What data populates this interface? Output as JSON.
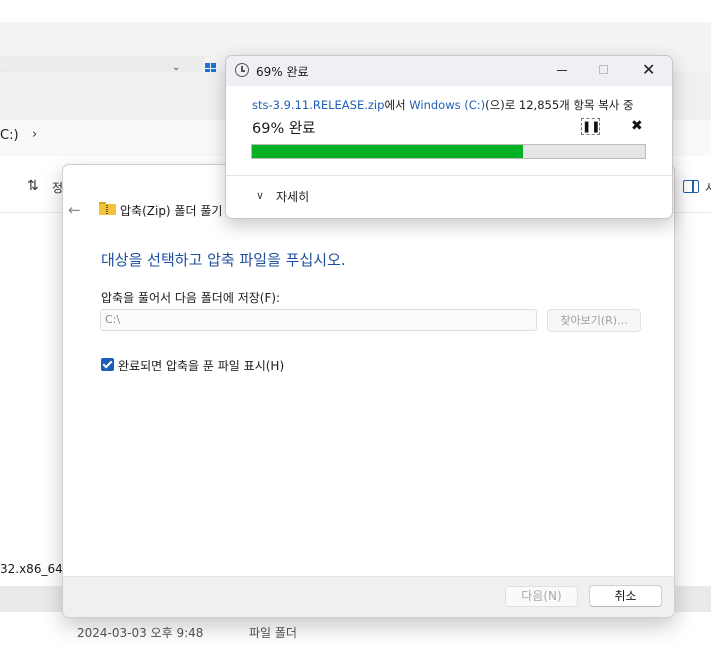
{
  "explorer": {
    "tab_partial": "‥‥",
    "tab_chevron": "⌄",
    "address_text": "C:)",
    "address_chevron": "›",
    "sort_icon": "⇅",
    "sort_label": "정",
    "details_label": "시",
    "file_partial_name": "32.x86_64...",
    "row_date": "2024-03-03 오후 9:48",
    "row_type": "파일 폴더"
  },
  "wizard": {
    "back_icon": "←",
    "title": "압축(Zip) 폴더 풀기",
    "heading": "대상을 선택하고 압축 파일을 푸십시오.",
    "dest_label": "압축을 풀어서 다음 폴더에 저장(F):",
    "dest_path": "C:\\",
    "browse_label": "찾아보기(R)...",
    "show_files_label": "완료되면 압축을 푼 파일 표시(H)",
    "show_files_checked": true,
    "next_label": "다음(N)",
    "cancel_label": "취소"
  },
  "progress_dialog": {
    "title": "69% 완료",
    "minimize_icon": "minimize-icon",
    "maximize_icon": "maximize-icon",
    "close_glyph": "✕",
    "source_file": "sts-3.9.11.RELEASE.zip",
    "source_suffix": "에서 ",
    "dest_name": "Windows (C:)",
    "dest_suffix": "(으)로 12,855개 항목 복사 중",
    "percent_text": "69% 완료",
    "progress_fraction": 0.69,
    "pause_glyph": "❚❚",
    "cancel_glyph": "✖",
    "details_chevron": "∨",
    "details_label": "자세히",
    "bar_color": "#06b025",
    "link_color": "#1f5fb5"
  }
}
